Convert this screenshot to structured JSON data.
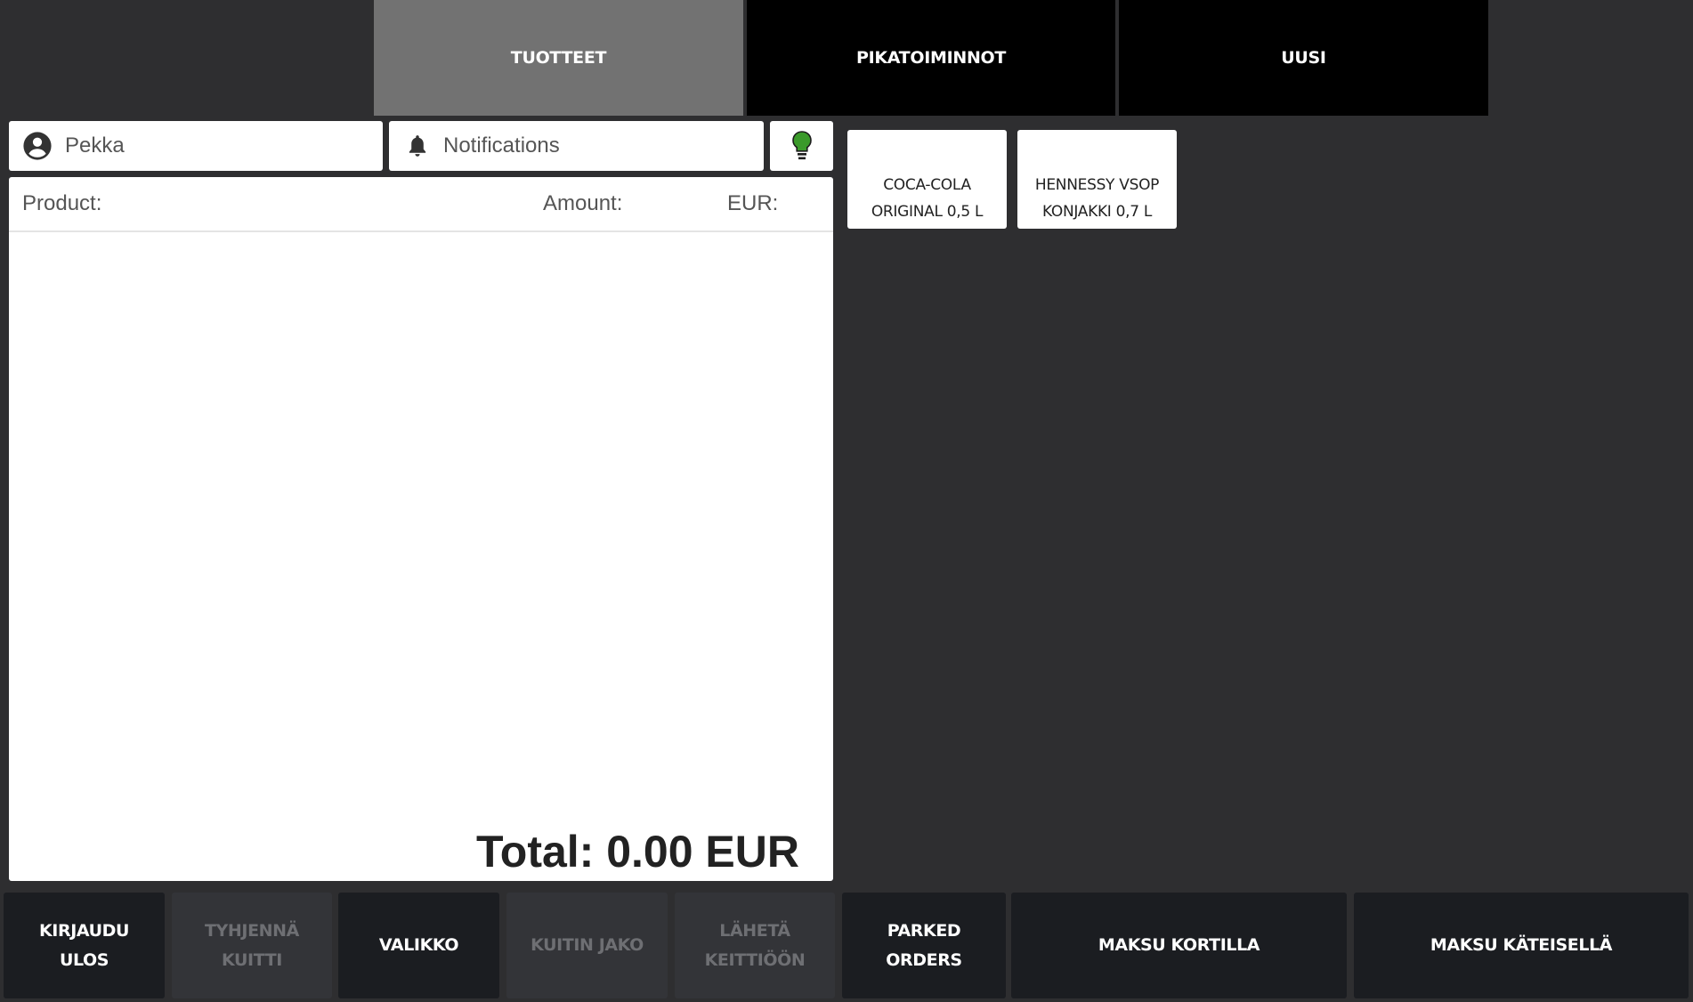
{
  "tabs": [
    {
      "label": "TUOTTEET",
      "active": true
    },
    {
      "label": "PIKATOIMINNOT",
      "active": false
    },
    {
      "label": "UUSI",
      "active": false
    }
  ],
  "header": {
    "user_name": "Pekka",
    "user_icon": "account-circle-icon",
    "notifications_label": "Notifications",
    "notifications_icon": "bell-icon",
    "status_icon": "lightbulb-icon",
    "status_color": "#3a9a2a"
  },
  "receipt": {
    "col_product": "Product:",
    "col_amount": "Amount:",
    "col_eur": "EUR:",
    "items": [],
    "total_text": "Total: 0.00 EUR"
  },
  "products": [
    {
      "line1": "COCA-COLA",
      "line2": "ORIGINAL 0,5 L"
    },
    {
      "line1": "HENNESSY VSOP",
      "line2": "KONJAKKI 0,7 L"
    }
  ],
  "bottom_buttons": [
    {
      "line1": "KIRJAUDU",
      "line2": "ULOS",
      "enabled": true
    },
    {
      "line1": "TYHJENNÄ",
      "line2": "KUITTI",
      "enabled": false
    },
    {
      "line1": "VALIKKO",
      "line2": "",
      "enabled": true
    },
    {
      "line1": "KUITIN JAKO",
      "line2": "",
      "enabled": false
    },
    {
      "line1": "LÄHETÄ",
      "line2": "KEITTIÖÖN",
      "enabled": false
    },
    {
      "line1": "PARKED",
      "line2": "ORDERS",
      "enabled": true
    },
    {
      "line1": "MAKSU KORTILLA",
      "line2": "",
      "enabled": true
    },
    {
      "line1": "MAKSU KÄTEISELLÄ",
      "line2": "",
      "enabled": true
    }
  ],
  "colors": {
    "background": "#2e2e30",
    "active_tab": "#727272",
    "inactive_tab": "#000000",
    "button": "#1b1d21",
    "button_disabled": "#333438"
  }
}
